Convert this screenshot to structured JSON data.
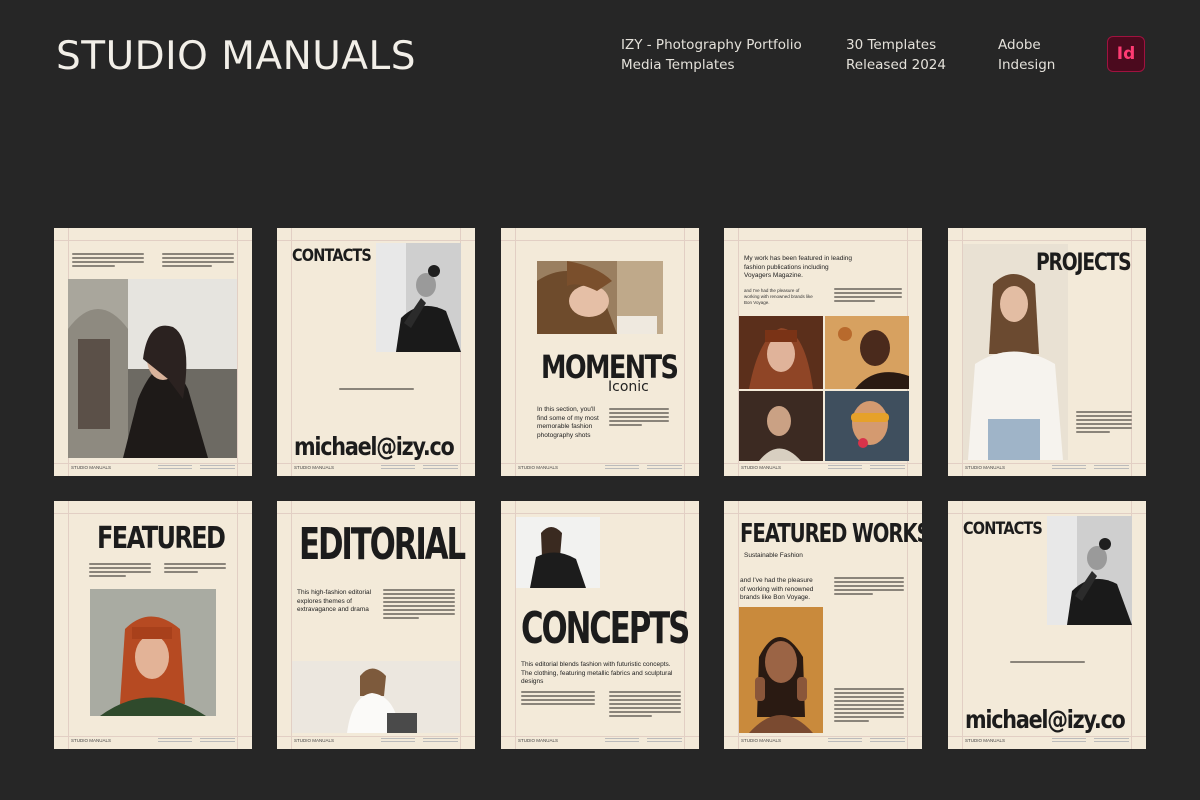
{
  "header": {
    "brand": "STUDIO MANUALS",
    "product_line1": "IZY - Photography Portfolio",
    "product_line2": "Media Templates",
    "count_line1": "30 Templates",
    "count_line2": "Released 2024",
    "app_line1": "Adobe",
    "app_line2": "Indesign",
    "app_badge": "Id"
  },
  "colors": {
    "background": "#262626",
    "page": "#f3ead9",
    "badge_bg": "#4b0a1e",
    "badge_text": "#ff3b73"
  },
  "footer_label": "STUDIO MANUALS",
  "cards": {
    "c2": {
      "title": "CONTACTS",
      "email": "michael@izy.co"
    },
    "c3": {
      "title": "MOMENTS",
      "subtitle": "Iconic",
      "body": "In this section, you'll find some of my most memorable fashion photography shots"
    },
    "c4": {
      "intro": "My work has been featured in leading fashion publications including Voyagers Magazine.",
      "body": "and I've had the pleasure of working with renowned brands like Bon Voyage."
    },
    "c5": {
      "title": "PROJECTS"
    },
    "c6": {
      "title": "FEATURED"
    },
    "c7": {
      "title": "EDITORIAL",
      "body": "This high-fashion editorial explores themes of extravagance and drama"
    },
    "c8": {
      "title": "CONCEPTS",
      "body": "This editorial blends fashion with futuristic concepts. The clothing, featuring metallic fabrics and sculptural designs"
    },
    "c9": {
      "title": "FEATURED WORKS",
      "subtitle": "Sustainable Fashion",
      "body": "and I've had the pleasure of working with renowned brands like Bon Voyage."
    },
    "c10": {
      "title": "CONTACTS",
      "email": "michael@izy.co"
    }
  }
}
